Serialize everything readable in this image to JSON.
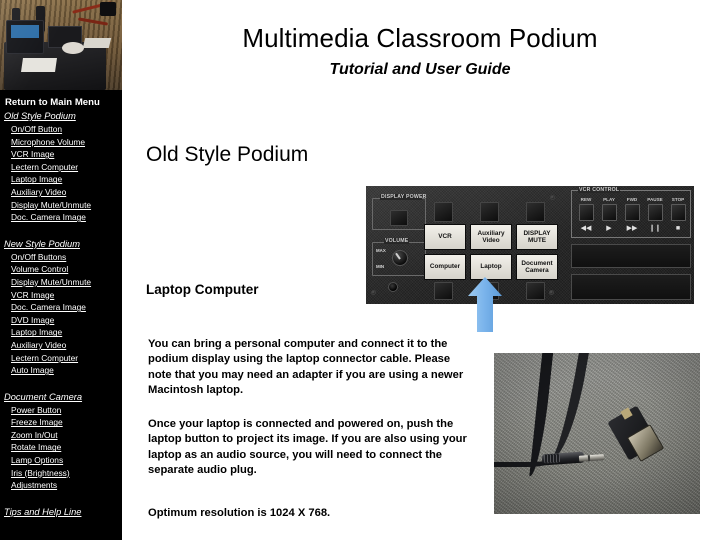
{
  "header": {
    "title": "Multimedia Classroom Podium",
    "subtitle": "Tutorial and User Guide"
  },
  "sidebar": {
    "photo_alt": "podium-photo",
    "background_color": "#000000",
    "text_color": "#ffffff",
    "home_link": "Return to Main Menu",
    "sections": [
      {
        "heading": "Old Style Podium",
        "items": [
          "On/Off Button",
          "Microphone Volume",
          "VCR Image",
          "Lectern Computer",
          "Laptop Image",
          "Auxiliary Video",
          "Display Mute/Unmute",
          "Doc. Camera Image"
        ]
      },
      {
        "heading": "New Style Podium",
        "items": [
          "On/Off Buttons",
          "Volume Control",
          "Display Mute/Unmute",
          "VCR Image",
          "Doc. Camera Image",
          "DVD Image",
          "Laptop Image",
          "Auxiliary Video",
          "Lectern Computer",
          "Auto Image"
        ]
      },
      {
        "heading": "Document Camera",
        "items": [
          "Power Button",
          "Freeze Image",
          "Zoom In/Out",
          "Rotate Image",
          "Lamp Options",
          "Iris (Brightness)",
          "Adjustments"
        ]
      }
    ],
    "footer_link": "Tips and Help Line"
  },
  "main": {
    "section_title": "Old Style Podium",
    "subsection_title": "Laptop Computer",
    "paragraphs": [
      "You can bring a personal computer and connect it to the podium display using the laptop connector cable. Please note that you may need an adapter if you are using a newer Macintosh laptop.",
      "Once your laptop is connected and powered on, push the laptop button to project its image. If you are also using your laptop as an audio source, you will need to connect the separate audio plug.",
      "Optimum resolution is 1024 X 768."
    ]
  },
  "control_panel": {
    "display_power_label": "DISPLAY POWER",
    "volume_label": "VOLUME",
    "volume_max": "MAX",
    "volume_min": "MIN",
    "source_buttons": [
      "VCR",
      "Auxiliary Video",
      "DISPLAY MUTE",
      "Computer",
      "Laptop",
      "Document Camera"
    ],
    "vcr_group_label": "VCR CONTROL",
    "vcr_buttons": [
      {
        "label": "REW",
        "glyph": "◀◀"
      },
      {
        "label": "PLAY",
        "glyph": "▶"
      },
      {
        "label": "FWD",
        "glyph": "▶▶"
      },
      {
        "label": "PAUSE",
        "glyph": "❙❙"
      },
      {
        "label": "STOP",
        "glyph": "■"
      }
    ]
  },
  "arrow": {
    "name": "up-arrow-callout",
    "color": "#7cb5ec",
    "points_to": "Laptop"
  },
  "cable_photo": {
    "name": "laptop-connector-cable-photo"
  }
}
